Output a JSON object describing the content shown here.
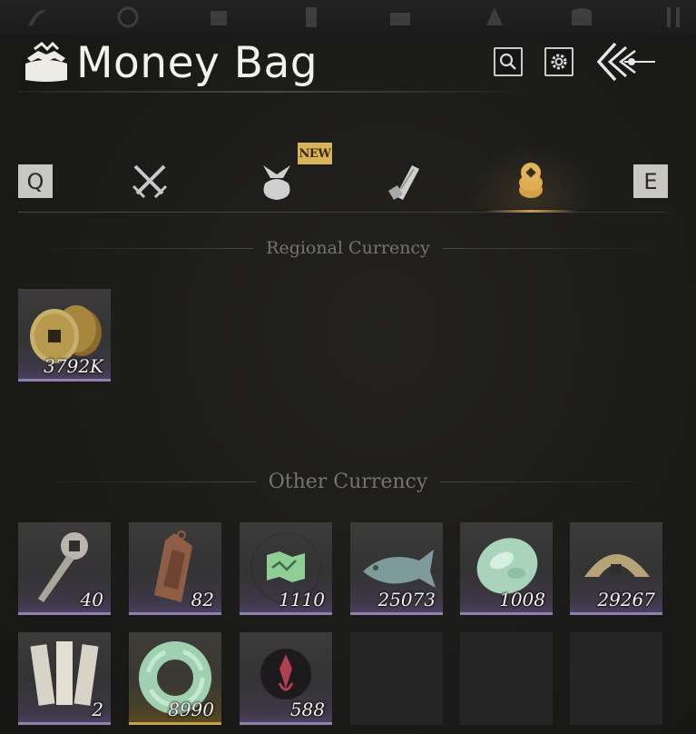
{
  "window": {
    "title": "Money Bag"
  },
  "top_bar": {
    "icons": [
      "decor-icon-1",
      "decor-icon-2",
      "decor-icon-3",
      "decor-icon-4",
      "decor-icon-5",
      "decor-icon-6",
      "decor-icon-7"
    ]
  },
  "header_buttons": {
    "search_icon": "search-icon",
    "settings_icon": "gear-icon",
    "back_icon": "back-arrow-icon"
  },
  "tabs": {
    "prev_key": "Q",
    "next_key": "E",
    "new_badge": "NEW",
    "items": [
      {
        "icon": "crossed-swords-icon",
        "active": false
      },
      {
        "icon": "bundle-bag-icon",
        "active": false,
        "badge": true
      },
      {
        "icon": "scroll-icon",
        "active": false
      },
      {
        "icon": "coin-stack-icon",
        "active": true
      }
    ]
  },
  "sections": {
    "regional": {
      "title": "Regional Currency",
      "items": [
        {
          "icon": "copper-coins-icon",
          "qty": "3792K"
        }
      ]
    },
    "other": {
      "title": "Other Currency",
      "items": [
        {
          "icon": "coin-key-icon",
          "qty": "40"
        },
        {
          "icon": "bronze-token-icon",
          "qty": "82"
        },
        {
          "icon": "map-icon",
          "qty": "1110"
        },
        {
          "icon": "jade-fish-icon",
          "qty": "25073"
        },
        {
          "icon": "jade-stone-icon",
          "qty": "1008"
        },
        {
          "icon": "half-coin-icon",
          "qty": "29267"
        },
        {
          "icon": "paper-notes-icon",
          "qty": "2"
        },
        {
          "icon": "jade-ring-icon",
          "qty": "8990"
        },
        {
          "icon": "red-sigil-icon",
          "qty": "588"
        }
      ]
    }
  },
  "colors": {
    "accent": "#d6a046",
    "rarity_purple": "#8f80ad",
    "rarity_gold": "#c2a247"
  }
}
